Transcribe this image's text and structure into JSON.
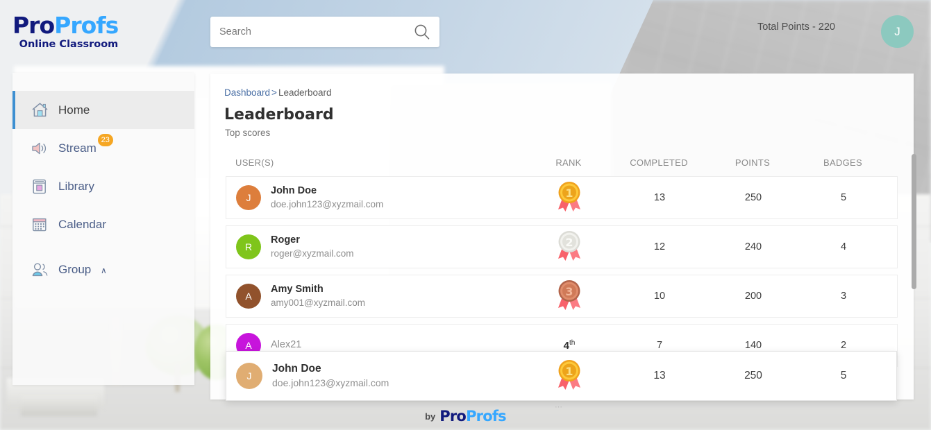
{
  "brand": {
    "pro": "Pro",
    "profs": "Profs",
    "tagline": "Online Classroom"
  },
  "header": {
    "search_placeholder": "Search",
    "search_value": "",
    "search_icon": "search-icon",
    "total_points": "Total Points - 220",
    "avatar_initial": "J",
    "avatar_color": "#8cc9bf"
  },
  "sidebar": {
    "items": [
      {
        "label": "Home",
        "icon": "home-icon",
        "active": true,
        "badge": ""
      },
      {
        "label": "Stream",
        "icon": "speaker-icon",
        "active": false,
        "badge": "23"
      },
      {
        "label": "Library",
        "icon": "book-icon",
        "active": false,
        "badge": ""
      },
      {
        "label": "Calendar",
        "icon": "calendar-icon",
        "active": false,
        "badge": ""
      },
      {
        "label": "Group",
        "icon": "group-icon",
        "active": false,
        "badge": "",
        "chevron": "∧"
      }
    ]
  },
  "main": {
    "breadcrumb": {
      "root": "Dashboard",
      "separator": ">",
      "current": "Leaderboard"
    },
    "title": "Leaderboard",
    "subtitle": "Top scores",
    "table": {
      "columns": [
        "USER(S)",
        "RANK",
        "COMPLETED",
        "POINTS",
        "BADGES"
      ],
      "rows": [
        {
          "name": "John Doe",
          "email": "doe.john123@xyzmail.com",
          "initial": "J",
          "avatar_color": "#dd7e3c",
          "rank": "1",
          "rank_type": "medal-gold",
          "completed": "13",
          "points": "250",
          "badges": "5"
        },
        {
          "name": "Roger",
          "email": "roger@xyzmail.com",
          "initial": "R",
          "avatar_color": "#7fc51b",
          "rank": "2",
          "rank_type": "medal-silver",
          "completed": "12",
          "points": "240",
          "badges": "4"
        },
        {
          "name": "Amy Smith",
          "email": "amy001@xyzmail.com",
          "initial": "A",
          "avatar_color": "#91522c",
          "rank": "3",
          "rank_type": "medal-bronze",
          "completed": "10",
          "points": "200",
          "badges": "3"
        },
        {
          "name": "Alex21",
          "email": "",
          "initial": "A",
          "avatar_color": "#c714dc",
          "rank": "4",
          "rank_suffix": "th",
          "rank_type": "text",
          "completed": "7",
          "points": "140",
          "badges": "2"
        }
      ]
    },
    "highlighted_row": {
      "name": "John Doe",
      "email": "doe.john123@xyzmail.com",
      "initial": "J",
      "avatar_color": "#e0ad72",
      "rank": "1",
      "rank_type": "medal-gold",
      "completed": "13",
      "points": "250",
      "badges": "5"
    },
    "scrollbar": {
      "color": "#ababab"
    }
  },
  "footer": {
    "by": "by",
    "pro": "Pro",
    "profs": "Profs"
  },
  "colors": {
    "accent": "#3d8fd1",
    "badge": "#f5a623",
    "link": "#4a6fa5"
  }
}
